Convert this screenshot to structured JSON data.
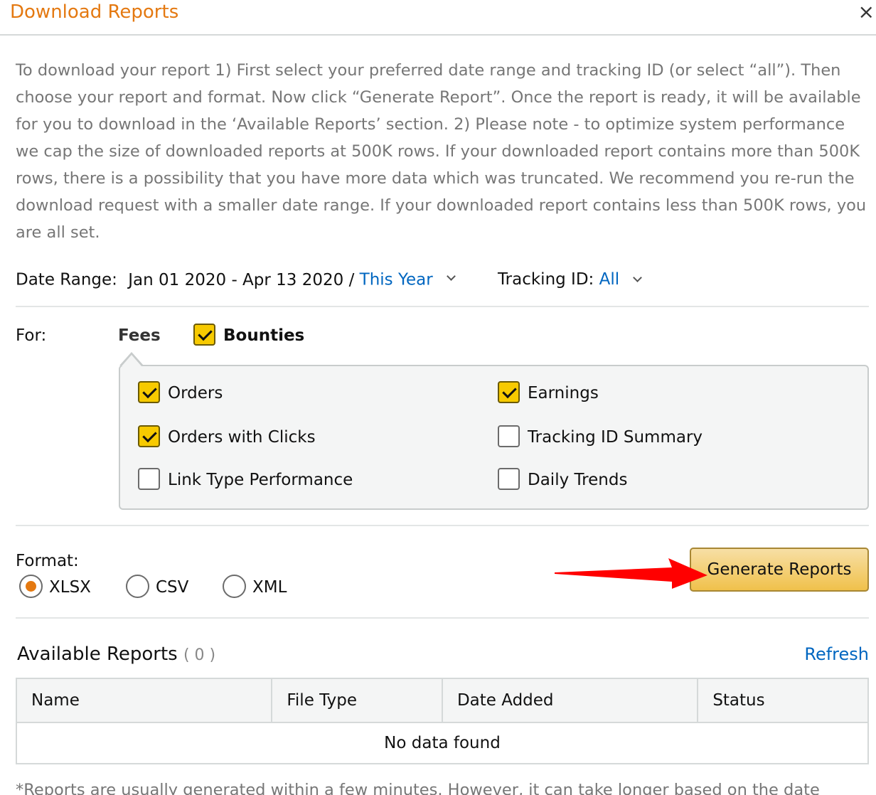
{
  "dialog": {
    "title": "Download Reports",
    "close_label": "×"
  },
  "intro_text": "To download your report 1) First select your preferred date range and tracking ID (or select “all”). Then choose your report and format. Now click “Generate Report”. Once the report is ready, it will be available for you to download in the ‘Available Reports’ section. 2) Please note - to optimize system performance we cap the size of downloaded reports at 500K rows. If your downloaded report contains more than 500K rows, there is a possibility that you have more data which was truncated. We recommend you re-run the download request with a smaller date range. If your downloaded report contains less than 500K rows, you are all set.",
  "filters": {
    "date_range_label": "Date Range:",
    "date_range_value": "Jan 01 2020 - Apr 13 2020 /",
    "date_preset": "This Year",
    "tracking_label": "Tracking ID:",
    "tracking_value": "All"
  },
  "report_for": {
    "label": "For:",
    "tabs": [
      {
        "label": "Fees",
        "checked": false
      },
      {
        "label": "Bounties",
        "checked": true
      }
    ],
    "options": [
      {
        "label": "Orders",
        "checked": true
      },
      {
        "label": "Earnings",
        "checked": true
      },
      {
        "label": "Orders with Clicks",
        "checked": true
      },
      {
        "label": "Tracking ID Summary",
        "checked": false
      },
      {
        "label": "Link Type Performance",
        "checked": false
      },
      {
        "label": "Daily Trends",
        "checked": false
      }
    ]
  },
  "format": {
    "label": "Format:",
    "options": [
      {
        "label": "XLSX",
        "selected": true
      },
      {
        "label": "CSV",
        "selected": false
      },
      {
        "label": "XML",
        "selected": false
      }
    ]
  },
  "generate_button": "Generate Reports",
  "available_reports": {
    "title": "Available Reports",
    "count": "( 0 )",
    "refresh": "Refresh",
    "columns": [
      "Name",
      "File Type",
      "Date Added",
      "Status"
    ],
    "empty_message": "No data found"
  },
  "footnote": "*Reports are usually generated within a few minutes. However, it can take longer based on the date",
  "colors": {
    "accent_orange": "#e47911",
    "link_blue": "#0066c0",
    "checkbox_yellow": "#f7ca00",
    "arrow_red": "#ff0000"
  }
}
